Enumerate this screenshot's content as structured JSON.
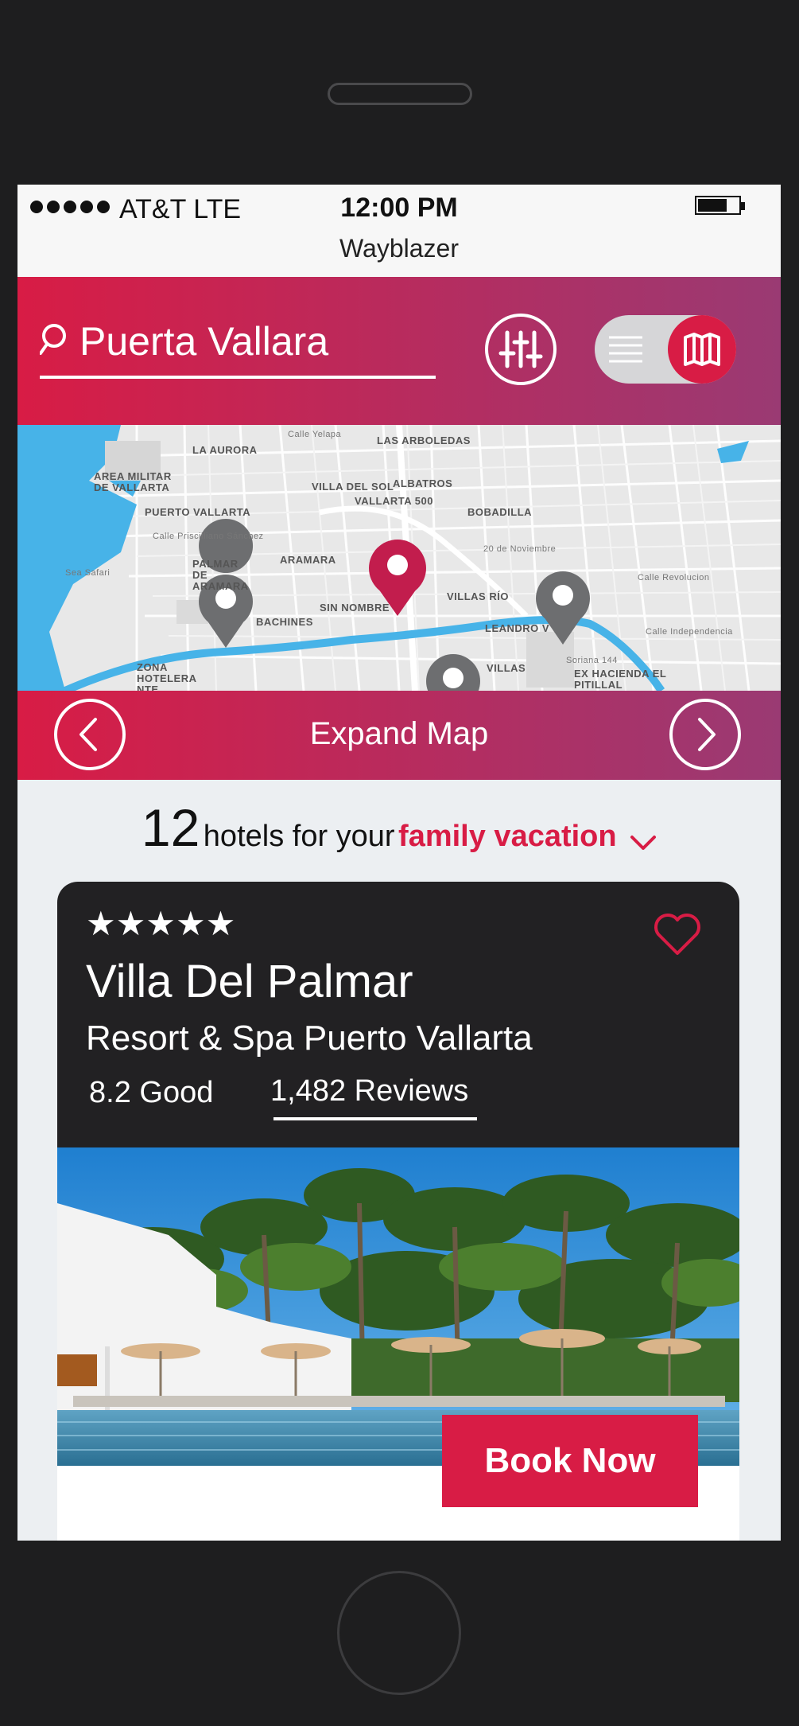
{
  "status_bar": {
    "carrier": "AT&T  LTE",
    "time": "12:00 PM",
    "app_title": "Wayblazer"
  },
  "search": {
    "query": "Puerta Vallara",
    "icon": "search-icon",
    "filter_icon": "sliders-icon",
    "toggle_list_icon": "list-icon",
    "toggle_map_icon": "map-icon"
  },
  "map": {
    "labels": [
      "LA AURORA",
      "LAS ARBOLEDAS",
      "AREA MILITAR DE VALLARTA",
      "VILLA DEL SOL",
      "ALBATROS",
      "VALLARTA 500",
      "BOBADILLA",
      "PUERTO VALLARTA",
      "ARAMARA",
      "PALMAR DE ARAMARA",
      "VILLAS RÍO",
      "SIN NOMBRE",
      "LEANDRO V",
      "BACHINES",
      "ZONA HOTELERA NTE.",
      "VILLAS",
      "EX HACIENDA EL PITILLAL",
      "Sea Safari",
      "Soriana 144"
    ],
    "small_labels": [
      "Calle Yelapa",
      "Calle Priscilliano Sánchez",
      "Calle Revolucion",
      "20 de Noviembre",
      "Calle Independencia"
    ]
  },
  "expand": {
    "label": "Expand Map",
    "prev_icon": "chevron-left-icon",
    "next_icon": "chevron-right-icon"
  },
  "results": {
    "count": "12",
    "text": "hotels for your",
    "filter": "family vacation"
  },
  "hotel": {
    "stars": 5,
    "stars_text": "★★★★★",
    "name": "Villa Del Palmar",
    "subtitle": "Resort & Spa Puerto Vallarta",
    "rating": "8.2 Good",
    "reviews": "1,482 Reviews",
    "book_label": "Book Now"
  },
  "colors": {
    "accent": "#d81c45",
    "accent_end": "#9a3a73",
    "card_dark": "#222123"
  }
}
